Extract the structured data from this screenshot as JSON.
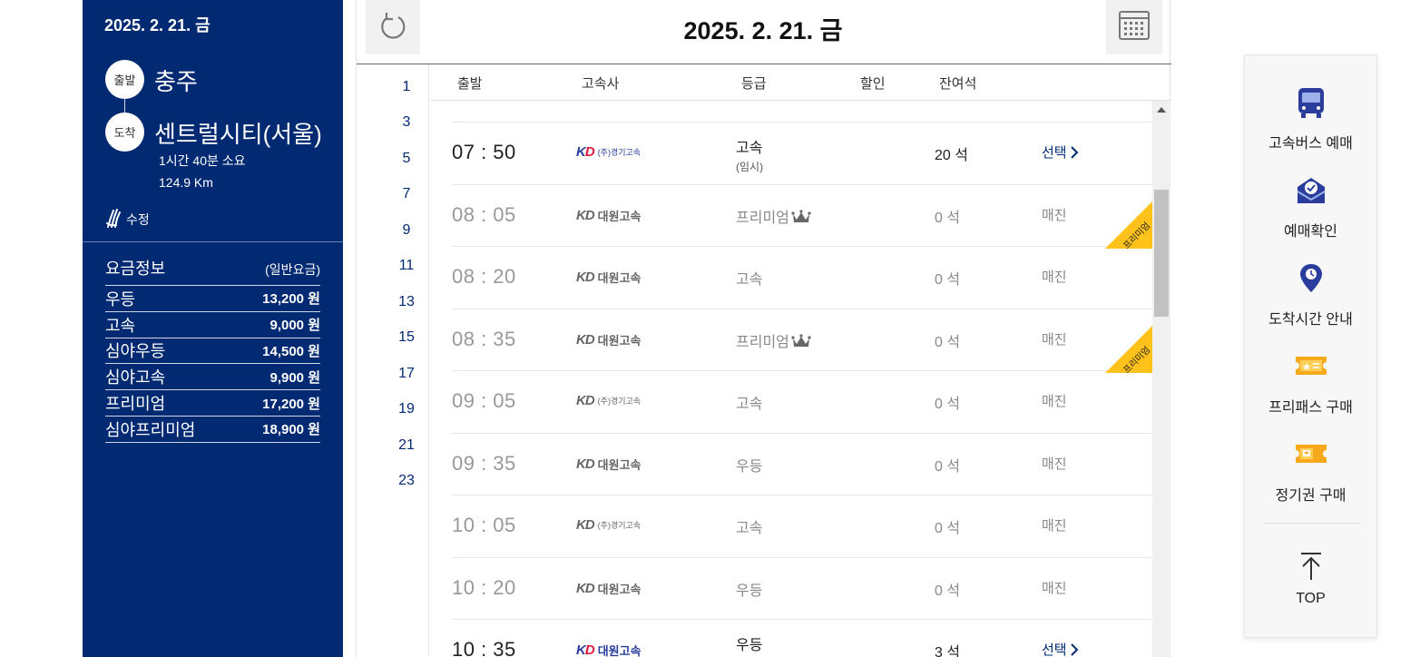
{
  "sidebar": {
    "date": "2025. 2. 21. 금",
    "departure_badge": "출발",
    "departure": "충주",
    "arrival_badge": "도착",
    "arrival": "센트럴시티(서울)",
    "duration": "1시간 40분 소요",
    "distance": "124.9 Km",
    "edit_label": "수정",
    "fare_title": "요금정보",
    "fare_subtitle": "(일반요금)",
    "fares": [
      {
        "name": "우등",
        "price": "13,200 원"
      },
      {
        "name": "고속",
        "price": "9,000 원"
      },
      {
        "name": "심야우등",
        "price": "14,500 원"
      },
      {
        "name": "심야고속",
        "price": "9,900 원"
      },
      {
        "name": "프리미엄",
        "price": "17,200 원"
      },
      {
        "name": "심야프리미엄",
        "price": "18,900 원"
      }
    ]
  },
  "main": {
    "date": "2025. 2. 21. 금",
    "hours": [
      "1",
      "3",
      "5",
      "7",
      "9",
      "11",
      "13",
      "15",
      "17",
      "19",
      "21",
      "23"
    ],
    "columns": {
      "depart": "출발",
      "company": "고속사",
      "grade": "등급",
      "discount": "할인",
      "seats": "잔여석"
    },
    "rows": [
      {
        "time": "07 : 50",
        "company_kd": "KD",
        "company": "(주)경기고속",
        "grade": "고속",
        "grade_sub": "(임시)",
        "seats": "20 석",
        "action": "선택",
        "available": true,
        "premium": false
      },
      {
        "time": "08 : 05",
        "company_kd": "KD",
        "company": "대원고속",
        "grade": "프리미엄",
        "grade_sub": "",
        "seats": "0 석",
        "action": "매진",
        "available": false,
        "premium": true
      },
      {
        "time": "08 : 20",
        "company_kd": "KD",
        "company": "대원고속",
        "grade": "고속",
        "grade_sub": "",
        "seats": "0 석",
        "action": "매진",
        "available": false,
        "premium": false
      },
      {
        "time": "08 : 35",
        "company_kd": "KD",
        "company": "대원고속",
        "grade": "프리미엄",
        "grade_sub": "",
        "seats": "0 석",
        "action": "매진",
        "available": false,
        "premium": true
      },
      {
        "time": "09 : 05",
        "company_kd": "KD",
        "company": "(주)경기고속",
        "grade": "고속",
        "grade_sub": "",
        "seats": "0 석",
        "action": "매진",
        "available": false,
        "premium": false
      },
      {
        "time": "09 : 35",
        "company_kd": "KD",
        "company": "대원고속",
        "grade": "우등",
        "grade_sub": "",
        "seats": "0 석",
        "action": "매진",
        "available": false,
        "premium": false
      },
      {
        "time": "10 : 05",
        "company_kd": "KD",
        "company": "(주)경기고속",
        "grade": "고속",
        "grade_sub": "",
        "seats": "0 석",
        "action": "매진",
        "available": false,
        "premium": false
      },
      {
        "time": "10 : 20",
        "company_kd": "KD",
        "company": "대원고속",
        "grade": "우등",
        "grade_sub": "",
        "seats": "0 석",
        "action": "매진",
        "available": false,
        "premium": false
      },
      {
        "time": "10 : 35",
        "company_kd": "KD",
        "company": "대원고속",
        "grade": "우등",
        "grade_sub": "",
        "seats": "3 석",
        "action": "선택",
        "available": true,
        "premium": false
      }
    ],
    "premium_ribbon": "프리미엄"
  },
  "quick_menu": {
    "items": [
      {
        "label": "고속버스 예매",
        "icon": "bus-icon"
      },
      {
        "label": "예매확인",
        "icon": "ticket-check-icon"
      },
      {
        "label": "도착시간 안내",
        "icon": "location-pin-icon"
      },
      {
        "label": "프리패스 구매",
        "icon": "free-pass-icon"
      },
      {
        "label": "정기권 구매",
        "icon": "season-ticket-icon"
      }
    ],
    "top_label": "TOP"
  },
  "colors": {
    "navy": "#012a73",
    "ribbon": "#ffc21a",
    "brand_red": "#e0183a"
  }
}
